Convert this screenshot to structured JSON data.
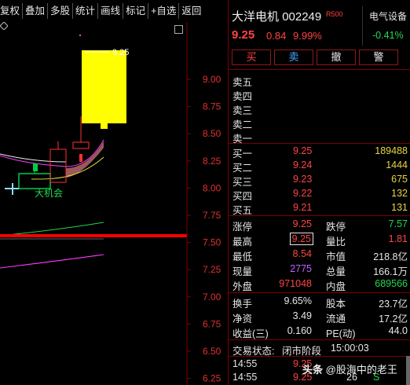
{
  "toolbar": {
    "buttons": [
      "复权",
      "叠加",
      "多股",
      "统计",
      "画线",
      "标记",
      "+自选",
      "返回"
    ]
  },
  "chart": {
    "price_axis": [
      "9.00",
      "8.75",
      "8.50",
      "8.25",
      "8.00",
      "7.75",
      "7.50",
      "7.25",
      "7.00",
      "6.75",
      "6.50",
      "6.25"
    ],
    "high_marker": "9.25",
    "annotation": "大机会",
    "colors": {
      "limit_up_candle": "#ffff00",
      "bull_candle": "#ff3030",
      "bear_candle": "#00cc44",
      "support_line": "#ff0000"
    }
  },
  "header": {
    "name": "大洋电机",
    "code": "002249",
    "tag": "R500",
    "price": "9.25",
    "change": "0.84",
    "pct": "9.99%",
    "industry": "电气设备",
    "industry_change": "-0.41%"
  },
  "actions": {
    "buy": "买",
    "sell": "卖",
    "cancel": "撤",
    "alert": "警"
  },
  "asks": [
    {
      "label": "卖五"
    },
    {
      "label": "卖四"
    },
    {
      "label": "卖三"
    },
    {
      "label": "卖二"
    },
    {
      "label": "卖一"
    }
  ],
  "bids": [
    {
      "label": "买一",
      "price": "9.25",
      "volume": "189488"
    },
    {
      "label": "买二",
      "price": "9.24",
      "volume": "1444"
    },
    {
      "label": "买三",
      "price": "9.23",
      "volume": "675"
    },
    {
      "label": "买四",
      "price": "9.22",
      "volume": "132"
    },
    {
      "label": "买五",
      "price": "9.21",
      "volume": "131"
    }
  ],
  "stats": {
    "limit_up_label": "涨停",
    "limit_up": "9.25",
    "limit_down_label": "跌停",
    "limit_down": "7.57",
    "high_label": "最高",
    "high": "9.25",
    "vol_ratio_label": "量比",
    "vol_ratio": "1.81",
    "low_label": "最低",
    "low": "8.54",
    "mkt_cap_label": "市值",
    "mkt_cap": "218.8亿",
    "cur_vol_label": "现量",
    "cur_vol": "2775",
    "total_vol_label": "总量",
    "total_vol": "166.1万",
    "outer_label": "外盘",
    "outer": "971048",
    "inner_label": "内盘",
    "inner": "689566",
    "turnover_label": "换手",
    "turnover": "9.65%",
    "equity_label": "股本",
    "equity": "23.7亿",
    "nav_label": "净资",
    "nav": "3.49",
    "float_label": "流通",
    "float": "17.2亿",
    "eps_label": "收益(三)",
    "eps": "0.160",
    "pe_label": "PE(动)",
    "pe": "44.0"
  },
  "status": {
    "label": "交易状态:",
    "phase": "闭市阶段",
    "time": "15:00:03"
  },
  "ticks": [
    {
      "time": "14:55",
      "price": "9.25"
    },
    {
      "time": "14:55",
      "price": "9.25",
      "vol": "26",
      "flag": "S"
    }
  ],
  "watermark": {
    "prefix": "头条",
    "text": "@股海中的老王"
  }
}
